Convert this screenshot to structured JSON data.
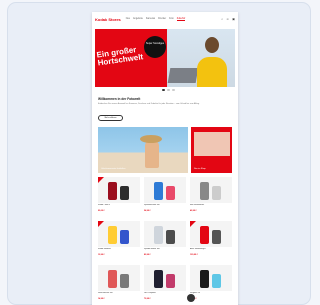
{
  "nav": {
    "logo": "Kodak Stores",
    "items": [
      "Neu",
      "Angebote",
      "Kameras",
      "Drucker",
      "Foto",
      "Zubehör",
      "Schule",
      "Sale"
    ],
    "active_index": 5,
    "icons": [
      "search-icon",
      "user-icon",
      "cart-icon"
    ]
  },
  "hero": {
    "headline": "Ein großer Hortschwelt",
    "badge": "Super Sonstiges"
  },
  "intro": {
    "title": "Willkommen in der Fotowelt",
    "text": "Entdecken Sie unsere Auswahl an Kameras, Druckern und Zubehör für jede Situation – vom Urlaub bis zum Alltag.",
    "button": "Mehr erfahren"
  },
  "banners": {
    "left_caption": "Urlaubsmomente festhalten",
    "right_caption": "Neu im Shop"
  },
  "products": [
    {
      "name": "Kodak - Mini 3",
      "price": "99,00 €",
      "colors": [
        "#9b0e1e",
        "#2d2d2d"
      ]
    },
    {
      "name": "Sprühflaschen Set",
      "price": "24,99 €",
      "colors": [
        "#2e7bd6",
        "#e94a6a"
      ]
    },
    {
      "name": "Mini Fotodrucker",
      "price": "49,99 €",
      "colors": [
        "#888888",
        "#cccccc"
      ]
    },
    {
      "name": "Kodak Fotobox",
      "price": "19,99 €",
      "colors": [
        "#ffcc33",
        "#3355cc"
      ]
    },
    {
      "name": "Sprudel Maker Set",
      "price": "89,99 €",
      "colors": [
        "#cfd5dc",
        "#4c4c4c"
      ]
    },
    {
      "name": "Akku Staubsauger",
      "price": "129,99 €",
      "colors": [
        "#e30613",
        "#555555"
      ]
    },
    {
      "name": "Retro Becher Set",
      "price": "14,99 €",
      "colors": [
        "#e05858",
        "#7a7a7a"
      ]
    },
    {
      "name": "LED Projektor",
      "price": "79,99 €",
      "colors": [
        "#202030",
        "#c23b6b"
      ]
    },
    {
      "name": "Ringlicht 10\"",
      "price": "29,99 €",
      "colors": [
        "#1a1a1a",
        "#5ec7e6"
      ]
    }
  ]
}
